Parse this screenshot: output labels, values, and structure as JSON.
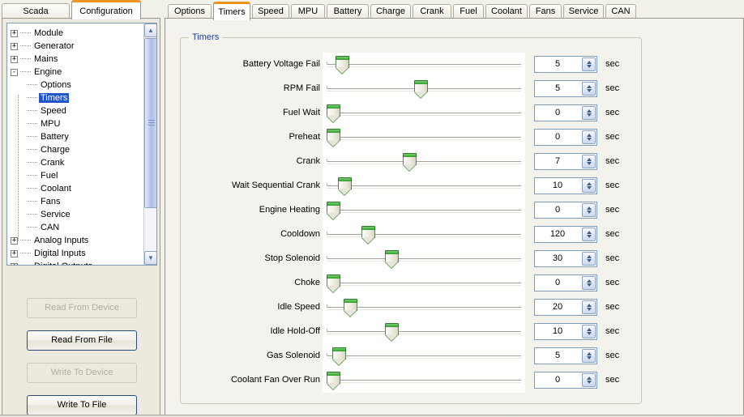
{
  "app": {
    "bottom_edge": ""
  },
  "left": {
    "tabs": [
      {
        "label": "Scada",
        "active": false
      },
      {
        "label": "Configuration",
        "active": true
      }
    ],
    "tree": [
      {
        "label": "Module",
        "level": 0,
        "expander": "+",
        "selected": false
      },
      {
        "label": "Generator",
        "level": 0,
        "expander": "+",
        "selected": false
      },
      {
        "label": "Mains",
        "level": 0,
        "expander": "+",
        "selected": false
      },
      {
        "label": "Engine",
        "level": 0,
        "expander": "-",
        "selected": false
      },
      {
        "label": "Options",
        "level": 1,
        "expander": "",
        "selected": false
      },
      {
        "label": "Timers",
        "level": 1,
        "expander": "",
        "selected": true
      },
      {
        "label": "Speed",
        "level": 1,
        "expander": "",
        "selected": false
      },
      {
        "label": "MPU",
        "level": 1,
        "expander": "",
        "selected": false
      },
      {
        "label": "Battery",
        "level": 1,
        "expander": "",
        "selected": false
      },
      {
        "label": "Charge",
        "level": 1,
        "expander": "",
        "selected": false
      },
      {
        "label": "Crank",
        "level": 1,
        "expander": "",
        "selected": false
      },
      {
        "label": "Fuel",
        "level": 1,
        "expander": "",
        "selected": false
      },
      {
        "label": "Coolant",
        "level": 1,
        "expander": "",
        "selected": false
      },
      {
        "label": "Fans",
        "level": 1,
        "expander": "",
        "selected": false
      },
      {
        "label": "Service",
        "level": 1,
        "expander": "",
        "selected": false
      },
      {
        "label": "CAN",
        "level": 1,
        "expander": "",
        "selected": false
      },
      {
        "label": "Analog Inputs",
        "level": 0,
        "expander": "+",
        "selected": false
      },
      {
        "label": "Digital Inputs",
        "level": 0,
        "expander": "+",
        "selected": false
      },
      {
        "label": "Digital Outputs",
        "level": 0,
        "expander": "+",
        "selected": false
      }
    ],
    "scrollbar": {
      "up_glyph": "▲",
      "down_glyph": "▼"
    },
    "buttons": [
      {
        "label": "Read From Device",
        "enabled": false
      },
      {
        "label": "Read From File",
        "enabled": true
      },
      {
        "label": "Write To Device",
        "enabled": false
      },
      {
        "label": "Write To File",
        "enabled": true
      }
    ]
  },
  "right": {
    "tabs": [
      {
        "label": "Options",
        "active": false
      },
      {
        "label": "Timers",
        "active": true
      },
      {
        "label": "Speed",
        "active": false
      },
      {
        "label": "MPU",
        "active": false
      },
      {
        "label": "Battery",
        "active": false
      },
      {
        "label": "Charge",
        "active": false
      },
      {
        "label": "Crank",
        "active": false
      },
      {
        "label": "Fuel",
        "active": false
      },
      {
        "label": "Coolant",
        "active": false
      },
      {
        "label": "Fans",
        "active": false
      },
      {
        "label": "Service",
        "active": false
      },
      {
        "label": "CAN",
        "active": false
      }
    ],
    "group_title": "Timers",
    "unit": "sec",
    "rows": [
      {
        "label": "Battery Voltage Fail",
        "value": "5",
        "unit": "sec",
        "slider_pct": 5.0
      },
      {
        "label": "RPM Fail",
        "value": "5",
        "unit": "sec",
        "slider_pct": 48.5
      },
      {
        "label": "Fuel Wait",
        "value": "0",
        "unit": "sec",
        "slider_pct": 0.0
      },
      {
        "label": "Preheat",
        "value": "0",
        "unit": "sec",
        "slider_pct": 0.0
      },
      {
        "label": "Crank",
        "value": "7",
        "unit": "sec",
        "slider_pct": 42.0
      },
      {
        "label": "Wait Sequential Crank",
        "value": "10",
        "unit": "sec",
        "slider_pct": 6.5
      },
      {
        "label": "Engine Heating",
        "value": "0",
        "unit": "sec",
        "slider_pct": 0.0
      },
      {
        "label": "Cooldown",
        "value": "120",
        "unit": "sec",
        "slider_pct": 19.5
      },
      {
        "label": "Stop Solenoid",
        "value": "30",
        "unit": "sec",
        "slider_pct": 32.5
      },
      {
        "label": "Choke",
        "value": "0",
        "unit": "sec",
        "slider_pct": 0.0
      },
      {
        "label": "Idle Speed",
        "value": "20",
        "unit": "sec",
        "slider_pct": 9.5
      },
      {
        "label": "Idle Hold-Off",
        "value": "10",
        "unit": "sec",
        "slider_pct": 32.5
      },
      {
        "label": "Gas Solenoid",
        "value": "5",
        "unit": "sec",
        "slider_pct": 3.0
      },
      {
        "label": "Coolant Fan Over Run",
        "value": "0",
        "unit": "sec",
        "slider_pct": 0.0
      }
    ]
  },
  "colors": {
    "accent_tab": "#f0921e",
    "group_title": "#1d3f96",
    "selection": "#2256c7",
    "slider_green": "#2f9c2b",
    "panel_bg": "#f3f2ec"
  }
}
